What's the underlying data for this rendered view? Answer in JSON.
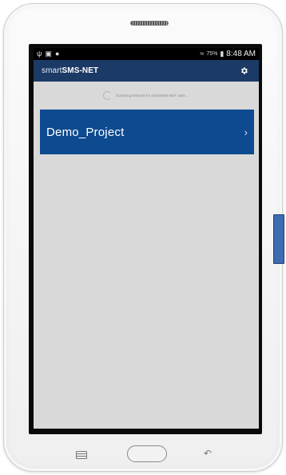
{
  "status_bar": {
    "battery_percent": "75%",
    "time": "8:48 AM",
    "icons": [
      "usb-icon",
      "image-icon",
      "notification-icon",
      "wifi-icon",
      "battery-icon"
    ]
  },
  "app_bar": {
    "title_light": "smart",
    "title_bold": "SMS-NET",
    "settings_icon": "gear-icon"
  },
  "scanning_text": "Scanning Network for smartSMS-NET units ...",
  "projects": [
    {
      "name": "Demo_Project",
      "chevron": "›"
    }
  ],
  "colors": {
    "app_bar": "#1c3a66",
    "project_card": "#0d4a8f",
    "background": "#d9d9d9"
  }
}
